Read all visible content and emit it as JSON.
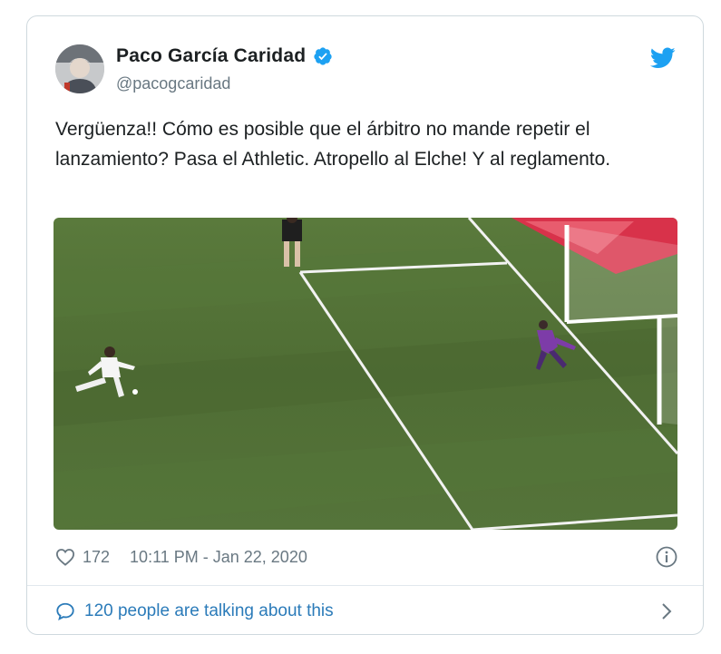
{
  "author": {
    "display_name": "Paco García Caridad",
    "handle": "@pacogcaridad",
    "avatar_icon": "avatar-photo",
    "verified_icon": "verified-badge-icon"
  },
  "tweet": {
    "text": "Vergüenza!! Cómo es posible que el árbitro no mande repetir el lanzamiento? Pasa el Athletic. Atropello al Elche! Y al reglamento.",
    "media_icon": "penalty-kick-photo"
  },
  "meta": {
    "like_count": "172",
    "timestamp": "10:11 PM - Jan 22, 2020"
  },
  "footer": {
    "conversation_text": "120 people are talking about this"
  },
  "colors": {
    "twitter_blue": "#1da1f2",
    "link_blue": "#2b7bb9",
    "muted_text": "#697882",
    "pitch_green": "#4f6b33"
  }
}
